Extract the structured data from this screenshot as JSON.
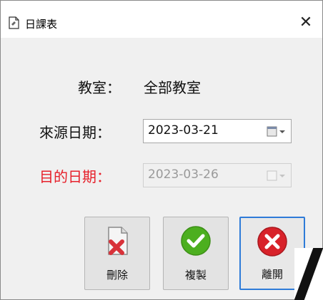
{
  "window": {
    "title": "日課表",
    "close_glyph": "✕"
  },
  "classroom": {
    "label": "教室：",
    "value": "全部教室"
  },
  "source_date": {
    "label": "來源日期：",
    "value": "2023-03-21"
  },
  "target_date": {
    "label": "目的日期：",
    "value": "2023-03-26",
    "label_color": "#e6202a"
  },
  "buttons": {
    "delete_label": "刪除",
    "copy_label": "複製",
    "exit_label": "離開"
  },
  "icons": {
    "title": "document-icon",
    "delete": "delete-document-icon",
    "copy": "check-circle-icon",
    "exit": "close-circle-icon",
    "calendar": "calendar-dropdown-icon"
  },
  "colors": {
    "accent": "#2e7bd8",
    "copy_green": "#4caf1f",
    "exit_red": "#d8222a"
  }
}
